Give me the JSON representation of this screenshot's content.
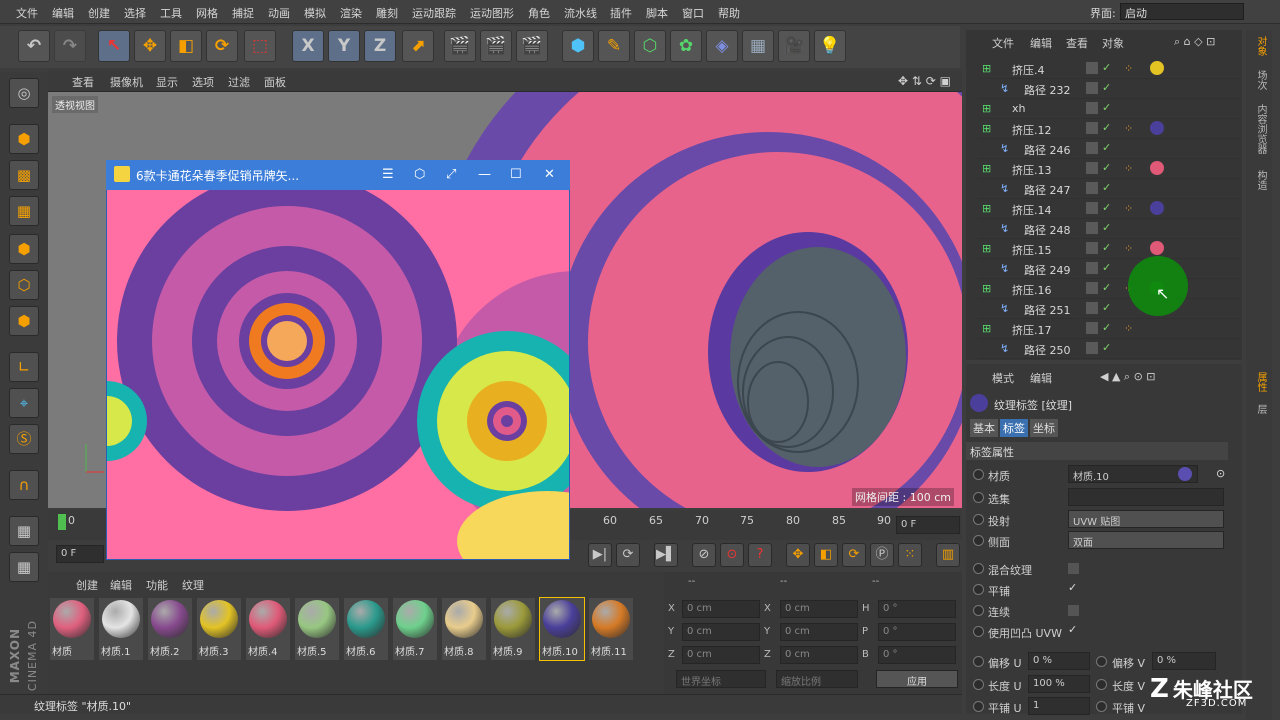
{
  "menubar": {
    "items": [
      "文件",
      "编辑",
      "创建",
      "选择",
      "工具",
      "网格",
      "捕捉",
      "动画",
      "模拟",
      "渲染",
      "雕刻",
      "运动跟踪",
      "运动图形",
      "角色",
      "流水线",
      "插件",
      "脚本",
      "窗口",
      "帮助"
    ],
    "layout_label": "界面:",
    "layout_value": "启动"
  },
  "toolbar": {
    "undo_icon": "undo-icon",
    "axis_x": "X",
    "axis_y": "Y",
    "axis_z": "Z"
  },
  "viewport": {
    "menu": [
      "查看",
      "摄像机",
      "显示",
      "选项",
      "过滤",
      "面板"
    ],
    "view_label": "透视视图",
    "grid_spacing": "网格间距 : 100 cm"
  },
  "timeline": {
    "ticks": [
      "0",
      "60",
      "65",
      "70",
      "75",
      "80",
      "85",
      "90"
    ],
    "start_frame": "0 F",
    "end_frame": "0 F"
  },
  "popup": {
    "title": "6款卡通花朵春季促销吊牌矢...",
    "icon": "image-icon"
  },
  "materials": {
    "menu": [
      "创建",
      "编辑",
      "功能",
      "纹理"
    ],
    "items": [
      {
        "name": "材质",
        "color": "#e0607f"
      },
      {
        "name": "材质.1",
        "color": "#e4e4e4"
      },
      {
        "name": "材质.2",
        "color": "#874a8e"
      },
      {
        "name": "材质.3",
        "color": "#e3c324"
      },
      {
        "name": "材质.4",
        "color": "#e05a78"
      },
      {
        "name": "材质.5",
        "color": "#97c782"
      },
      {
        "name": "材质.6",
        "color": "#2a9a8c"
      },
      {
        "name": "材质.7",
        "color": "#6ed08c"
      },
      {
        "name": "材质.8",
        "color": "#e8cc8c"
      },
      {
        "name": "材质.9",
        "color": "#9b9a3a"
      },
      {
        "name": "材质.10",
        "color": "#4a3f9a"
      },
      {
        "name": "材质.11",
        "color": "#d67a26"
      }
    ]
  },
  "coords": {
    "rows": [
      [
        "X",
        "0 cm",
        "X",
        "0 cm",
        "H",
        "0 °"
      ],
      [
        "Y",
        "0 cm",
        "Y",
        "0 cm",
        "P",
        "0 °"
      ],
      [
        "Z",
        "0 cm",
        "Z",
        "0 cm",
        "B",
        "0 °"
      ]
    ],
    "world_coords": "世界坐标",
    "scale_ratio": "缩放比例",
    "apply": "应用",
    "dashes": [
      "--",
      "--",
      "--"
    ]
  },
  "status": {
    "text": "纹理标签 \"材质.10\""
  },
  "objects": {
    "menu": [
      "文件",
      "编辑",
      "查看",
      "对象"
    ],
    "rows": [
      {
        "name": "挤压.4",
        "indent": 0,
        "ball": "#e3c324"
      },
      {
        "name": "路径 232",
        "indent": 1,
        "ball": ""
      },
      {
        "name": "xh",
        "indent": 0,
        "ball": ""
      },
      {
        "name": "挤压.12",
        "indent": 0,
        "ball": "#4a3f9a"
      },
      {
        "name": "路径 246",
        "indent": 1,
        "ball": ""
      },
      {
        "name": "挤压.13",
        "indent": 0,
        "ball": "#e05a78"
      },
      {
        "name": "路径 247",
        "indent": 1,
        "ball": ""
      },
      {
        "name": "挤压.14",
        "indent": 0,
        "ball": "#4a3f9a"
      },
      {
        "name": "路径 248",
        "indent": 1,
        "ball": ""
      },
      {
        "name": "挤压.15",
        "indent": 0,
        "ball": "#e05a78"
      },
      {
        "name": "路径 249",
        "indent": 1,
        "ball": ""
      },
      {
        "name": "挤压.16",
        "indent": 0,
        "ball": "#1a8a1a"
      },
      {
        "name": "路径 251",
        "indent": 1,
        "ball": ""
      },
      {
        "name": "挤压.17",
        "indent": 0,
        "ball": ""
      },
      {
        "name": "路径 250",
        "indent": 1,
        "ball": ""
      }
    ]
  },
  "attributes": {
    "menu": [
      "模式",
      "编辑"
    ],
    "title": "纹理标签 [纹理]",
    "tabs": [
      "基本",
      "标签",
      "坐标"
    ],
    "section": "标签属性",
    "material_label": "材质",
    "material_value": "材质.10",
    "selection_label": "选集",
    "projection_label": "投射",
    "projection_value": "UVW 贴图",
    "side_label": "侧面",
    "side_value": "双面",
    "mix_label": "混合纹理",
    "tile_label": "平铺",
    "seamless_label": "连续",
    "bump_label": "使用凹凸 UVW",
    "offset_u_label": "偏移 U",
    "offset_u_value": "0 %",
    "offset_v_label": "偏移 V",
    "offset_v_value": "0 %",
    "length_u_label": "长度 U",
    "length_u_value": "100 %",
    "length_v_label": "长度 V",
    "tile_u_label": "平铺 U",
    "tile_u_value": "1",
    "tile_v_label": "平铺 V"
  },
  "side_tabs": [
    "对象",
    "场次",
    "内容浏览器",
    "构造",
    "属性",
    "层"
  ],
  "brand": {
    "maxon": "MAXON",
    "c4d": "CINEMA 4D",
    "watermark": "朱峰社区",
    "watermark_sub": "ZF3D.COM"
  }
}
